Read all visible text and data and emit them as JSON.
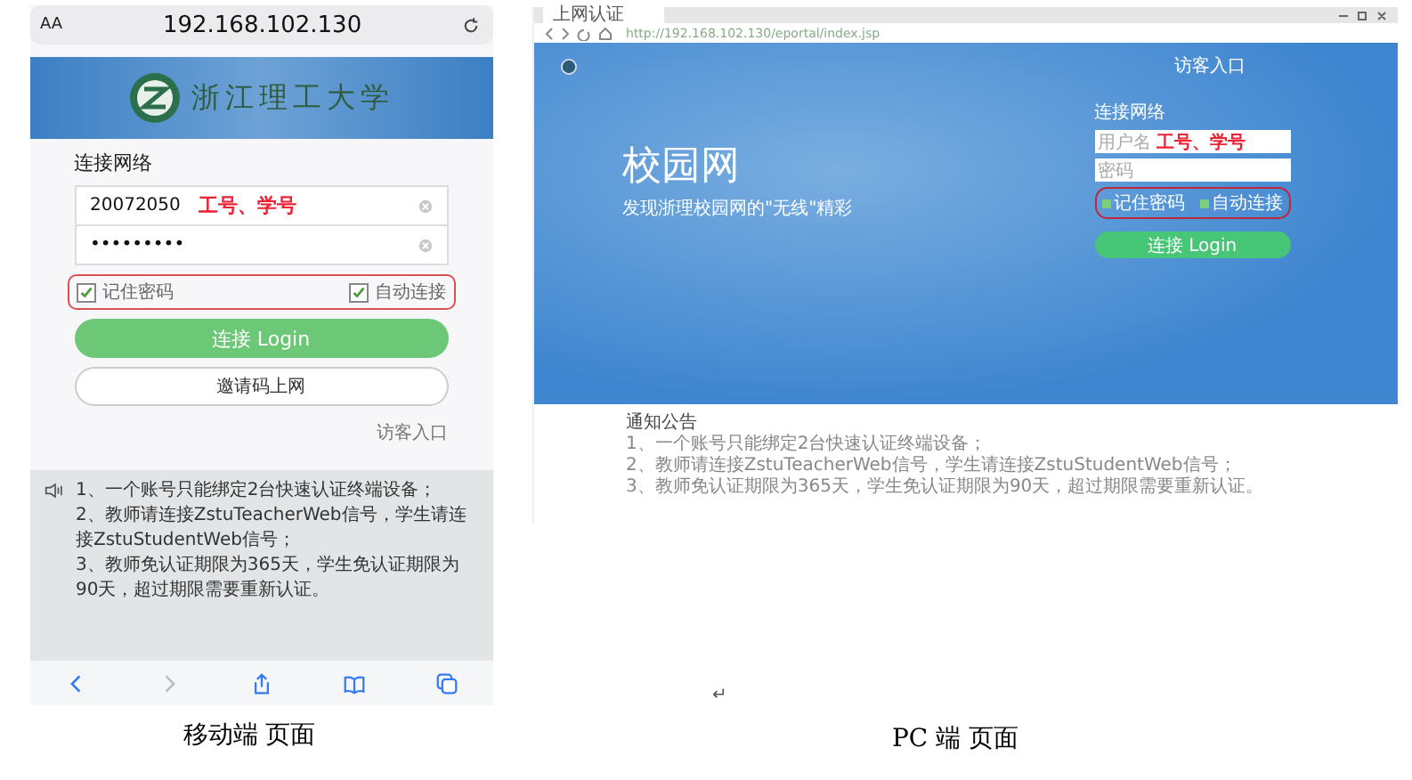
{
  "mobile": {
    "address_bar": {
      "text_size": "AA",
      "url": "192.168.102.130"
    },
    "banner": {
      "school_name": "浙江理工大学"
    },
    "form": {
      "title": "连接网络",
      "fields": [
        {
          "value": "20072050",
          "annotation": "工号、学号"
        },
        {
          "value": "•••••••••"
        }
      ],
      "checkboxes": [
        {
          "label": "记住密码",
          "checked": true
        },
        {
          "label": "自动连接",
          "checked": true
        }
      ],
      "login_button": "连接 Login",
      "invite_button": "邀请码上网",
      "guest_link": "访客入口"
    },
    "notices": [
      "1、一个账号只能绑定2台快速认证终端设备；",
      "2、教师请连接ZstuTeacherWeb信号，学生请连接ZstuStudentWeb信号；",
      "3、教师免认证期限为365天，学生免认证期限为90天，超过期限需要重新认证。"
    ],
    "caption": "移动端 页面"
  },
  "pc": {
    "tab": {
      "title": "上网认证"
    },
    "url": "http://192.168.102.130/eportal/index.jsp",
    "header": {
      "guest_link": "访客入口"
    },
    "hero": {
      "title": "校园网",
      "subtitle": "发现浙理校园网的\"无线\"精彩"
    },
    "form": {
      "title": "连接网络",
      "fields": [
        {
          "placeholder": "用户名",
          "annotation": "工号、学号"
        },
        {
          "placeholder": "密码"
        }
      ],
      "checkboxes": [
        {
          "label": "记住密码",
          "checked": true
        },
        {
          "label": "自动连接",
          "checked": true
        }
      ],
      "login_button": "连接 Login"
    },
    "notice": {
      "title": "通知公告",
      "items": [
        "1、一个账号只能绑定2台快速认证终端设备；",
        "2、教师请连接ZstuTeacherWeb信号，学生请连接ZstuStudentWeb信号；",
        "3、教师免认证期限为365天，学生免认证期限为90天，超过期限需要重新认证。"
      ]
    },
    "caption": "PC 端 页面"
  },
  "paragraph_mark": "↵"
}
